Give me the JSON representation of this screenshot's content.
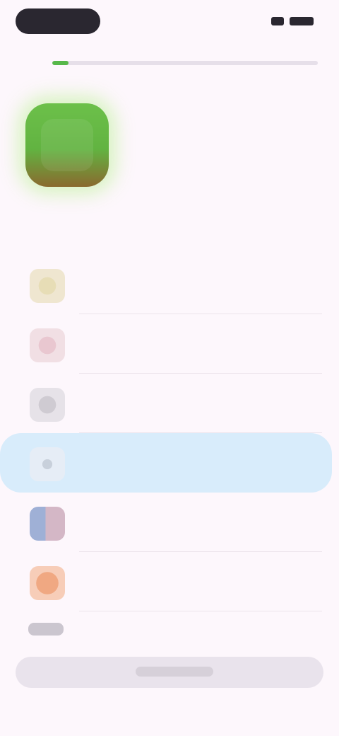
{
  "status_bar": {},
  "progress": {
    "fraction": 0.06
  },
  "app": {
    "title": "",
    "subtitle": ""
  },
  "section": {
    "title": ""
  },
  "list": {
    "items": [
      {
        "label": "",
        "icon": "category-icon",
        "selected": false
      },
      {
        "label": "",
        "icon": "category-icon",
        "selected": false
      },
      {
        "label": "",
        "icon": "category-icon",
        "selected": false
      },
      {
        "label": "",
        "icon": "category-icon",
        "selected": true
      },
      {
        "label": "",
        "icon": "category-icon",
        "selected": false
      },
      {
        "label": "",
        "icon": "category-icon",
        "selected": false
      }
    ]
  },
  "colors": {
    "accent_green": "#57b84a",
    "selected_row": "#d8ecfb",
    "background": "#fdf7fc"
  }
}
